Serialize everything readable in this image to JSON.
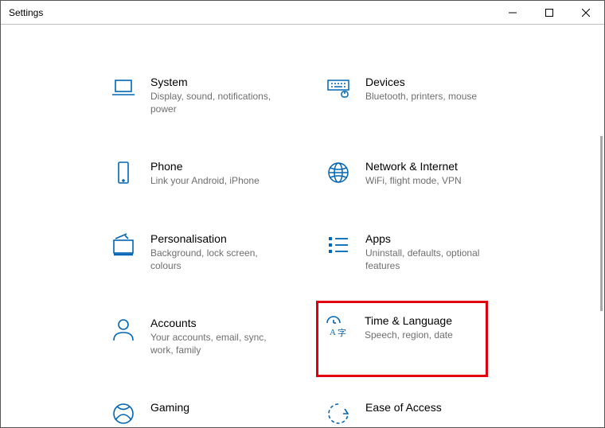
{
  "window": {
    "title": "Settings"
  },
  "tiles": [
    {
      "key": "system",
      "title": "System",
      "sub": "Display, sound, notifications, power",
      "icon": "laptop-icon"
    },
    {
      "key": "devices",
      "title": "Devices",
      "sub": "Bluetooth, printers, mouse",
      "icon": "keyboard-icon"
    },
    {
      "key": "phone",
      "title": "Phone",
      "sub": "Link your Android, iPhone",
      "icon": "phone-icon"
    },
    {
      "key": "network",
      "title": "Network & Internet",
      "sub": "WiFi, flight mode, VPN",
      "icon": "globe-icon"
    },
    {
      "key": "personalisation",
      "title": "Personalisation",
      "sub": "Background, lock screen, colours",
      "icon": "paint-icon"
    },
    {
      "key": "apps",
      "title": "Apps",
      "sub": "Uninstall, defaults, optional features",
      "icon": "list-icon"
    },
    {
      "key": "accounts",
      "title": "Accounts",
      "sub": "Your accounts, email, sync, work, family",
      "icon": "person-icon"
    },
    {
      "key": "time",
      "title": "Time & Language",
      "sub": "Speech, region, date",
      "icon": "clock-lang-icon",
      "highlight": true
    },
    {
      "key": "gaming",
      "title": "Gaming",
      "sub": "",
      "icon": "xbox-icon"
    },
    {
      "key": "ease",
      "title": "Ease of Access",
      "sub": "",
      "icon": "ease-icon"
    }
  ]
}
